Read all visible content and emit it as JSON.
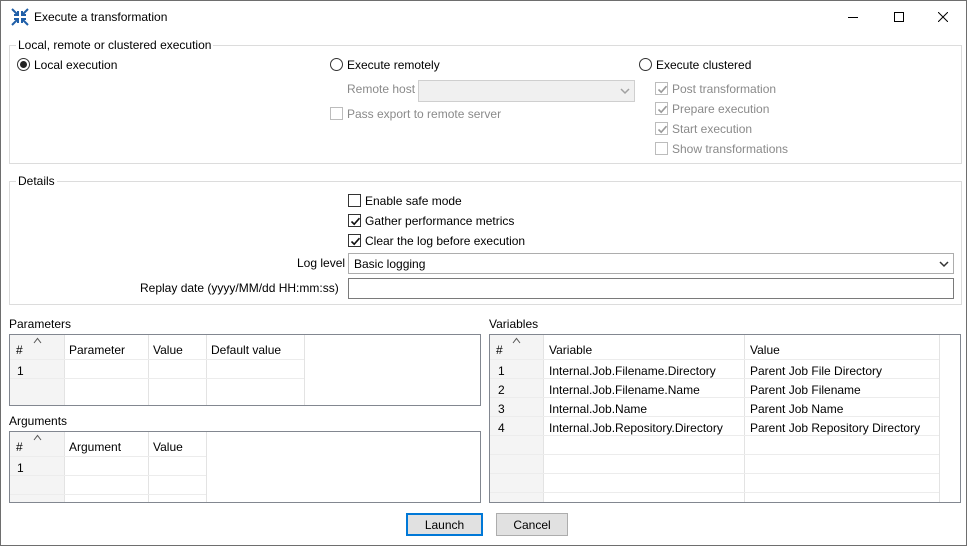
{
  "window": {
    "title": "Execute a transformation"
  },
  "execution": {
    "group_title": "Local, remote or clustered execution",
    "local_label": "Local execution",
    "remote_label": "Execute remotely",
    "clustered_label": "Execute clustered",
    "remote_host_label": "Remote host",
    "remote_host_value": "",
    "pass_export_label": "Pass export to remote server",
    "clustered_options": {
      "post": "Post transformation",
      "prepare": "Prepare execution",
      "start": "Start execution",
      "show": "Show transformations"
    }
  },
  "details": {
    "group_title": "Details",
    "safe_mode_label": "Enable safe mode",
    "gather_metrics_label": "Gather performance metrics",
    "clear_log_label": "Clear the log before execution",
    "log_level_label": "Log level",
    "log_level_value": "Basic logging",
    "replay_date_label": "Replay date (yyyy/MM/dd HH:mm:ss)",
    "replay_date_value": ""
  },
  "parameters": {
    "title": "Parameters",
    "columns": [
      "#",
      "Parameter",
      "Value",
      "Default value"
    ],
    "rows": [
      {
        "num": "1",
        "parameter": "",
        "value": "",
        "default": ""
      }
    ]
  },
  "arguments": {
    "title": "Arguments",
    "columns": [
      "#",
      "Argument",
      "Value"
    ],
    "rows": [
      {
        "num": "1",
        "argument": "",
        "value": ""
      }
    ]
  },
  "variables": {
    "title": "Variables",
    "columns": [
      "#",
      "Variable",
      "Value"
    ],
    "rows": [
      {
        "num": "1",
        "variable": "Internal.Job.Filename.Directory",
        "value": "Parent Job File Directory"
      },
      {
        "num": "2",
        "variable": "Internal.Job.Filename.Name",
        "value": "Parent Job Filename"
      },
      {
        "num": "3",
        "variable": "Internal.Job.Name",
        "value": "Parent Job Name"
      },
      {
        "num": "4",
        "variable": "Internal.Job.Repository.Directory",
        "value": "Parent Job Repository Directory"
      }
    ]
  },
  "buttons": {
    "launch": "Launch",
    "cancel": "Cancel"
  },
  "icons": {
    "app": "transformation-icon",
    "minimize": "minimize-icon",
    "maximize": "maximize-icon",
    "close": "close-icon",
    "sort": "caret-up-icon",
    "dropdown": "chevron-down-icon",
    "check": "check-icon"
  },
  "colors": {
    "accent": "#0078d7",
    "app_icon": "#1f5fa8"
  }
}
